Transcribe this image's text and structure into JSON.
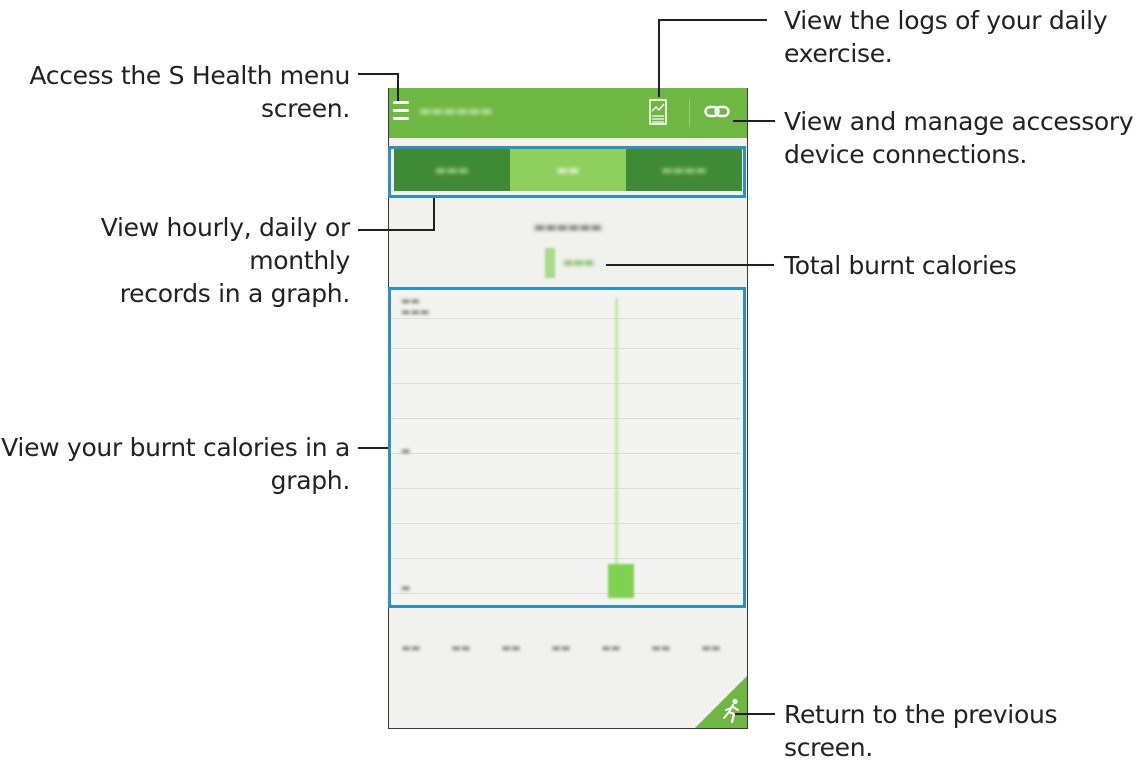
{
  "annotations": {
    "menu": [
      "Access the S Health menu",
      "screen."
    ],
    "period": [
      "View hourly, daily or monthly",
      "records in a graph."
    ],
    "graph": [
      "View your burnt calories in a",
      "graph."
    ],
    "logs": [
      "View the logs of your daily",
      "exercise."
    ],
    "accessory": [
      "View and manage accessory",
      "device connections."
    ],
    "total": [
      "Total burnt calories"
    ],
    "back": [
      "Return to the previous screen."
    ]
  },
  "colors": {
    "accent": "#6fb743",
    "tab_dark": "#3f8a35",
    "tab_active": "#8fcf5e",
    "highlight": "#2f8fc1"
  },
  "icons": {
    "menu": "hamburger-menu-icon",
    "logs": "exercise-log-icon",
    "accessory": "link-icon",
    "back": "running-person-icon"
  }
}
